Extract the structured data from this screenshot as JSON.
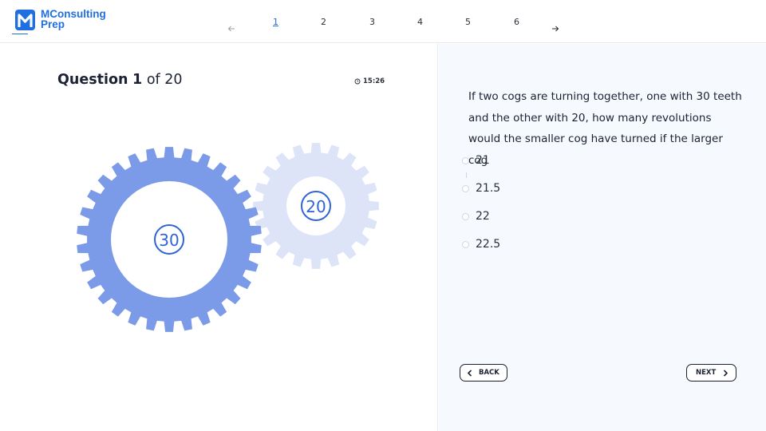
{
  "brand": {
    "name_line1": "MConsulting",
    "name_line2": "Prep",
    "color": "#1f6fe0"
  },
  "pagination": {
    "prev_icon": "arrow-left-icon",
    "next_icon": "arrow-right-icon",
    "pages": [
      "1",
      "2",
      "3",
      "4",
      "5",
      "6"
    ],
    "active_page": "1"
  },
  "question": {
    "label": "Question",
    "number": "1",
    "of_text": "of 20",
    "timer": "15:26",
    "timer_icon": "clock-icon",
    "text": "If two cogs are turning together, one with 30 teeth and the other with 20, how many revolutions would the smaller cog have turned if the larger cog",
    "options": [
      "21",
      "21.5",
      "22",
      "22.5"
    ]
  },
  "illustration": {
    "large_cog_label": "30",
    "small_cog_label": "20",
    "large_cog_teeth": 30,
    "small_cog_teeth": 20,
    "large_cog_color": "#7b9ae7",
    "small_cog_color": "#dde4f8",
    "number_color": "#2f63d8"
  },
  "nav": {
    "back_label": "BACK",
    "next_label": "NEXT"
  }
}
